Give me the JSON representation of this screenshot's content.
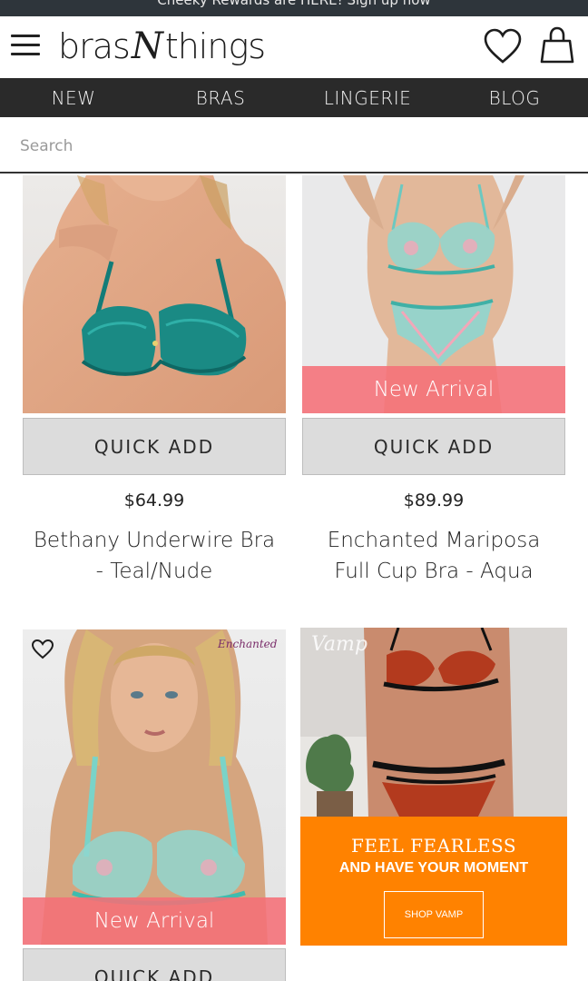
{
  "promo": {
    "text": "Cheeky Rewards are HERE! Sign up now"
  },
  "header": {
    "logo_word1": "bras",
    "logo_n": "N",
    "logo_word2": "things"
  },
  "nav": {
    "items": [
      "NEW",
      "BRAS",
      "LINGERIE",
      "BLOG"
    ]
  },
  "search": {
    "placeholder": "Search"
  },
  "products": [
    {
      "quick_add": "QUICK ADD",
      "price": "$64.99",
      "name_line1": "Bethany Underwire Bra",
      "name_line2": "- Teal/Nude"
    },
    {
      "badge": "New Arrival",
      "quick_add": "QUICK ADD",
      "price": "$89.99",
      "name_line1": "Enchanted Mariposa",
      "name_line2": "Full Cup Bra - Aqua"
    },
    {
      "tag": "Enchanted",
      "badge": "New Arrival",
      "quick_add": "QUICK ADD"
    }
  ],
  "banner": {
    "brand": "Vamp",
    "headline": "FEEL FEARLESS",
    "subheadline": "AND HAVE YOUR MOMENT",
    "cta": "SHOP VAMP",
    "color": "#ff8200"
  },
  "colors": {
    "nav_bg": "#2a2a2a",
    "badge": "#f57078",
    "quick_add_bg": "#dcdcdc"
  }
}
